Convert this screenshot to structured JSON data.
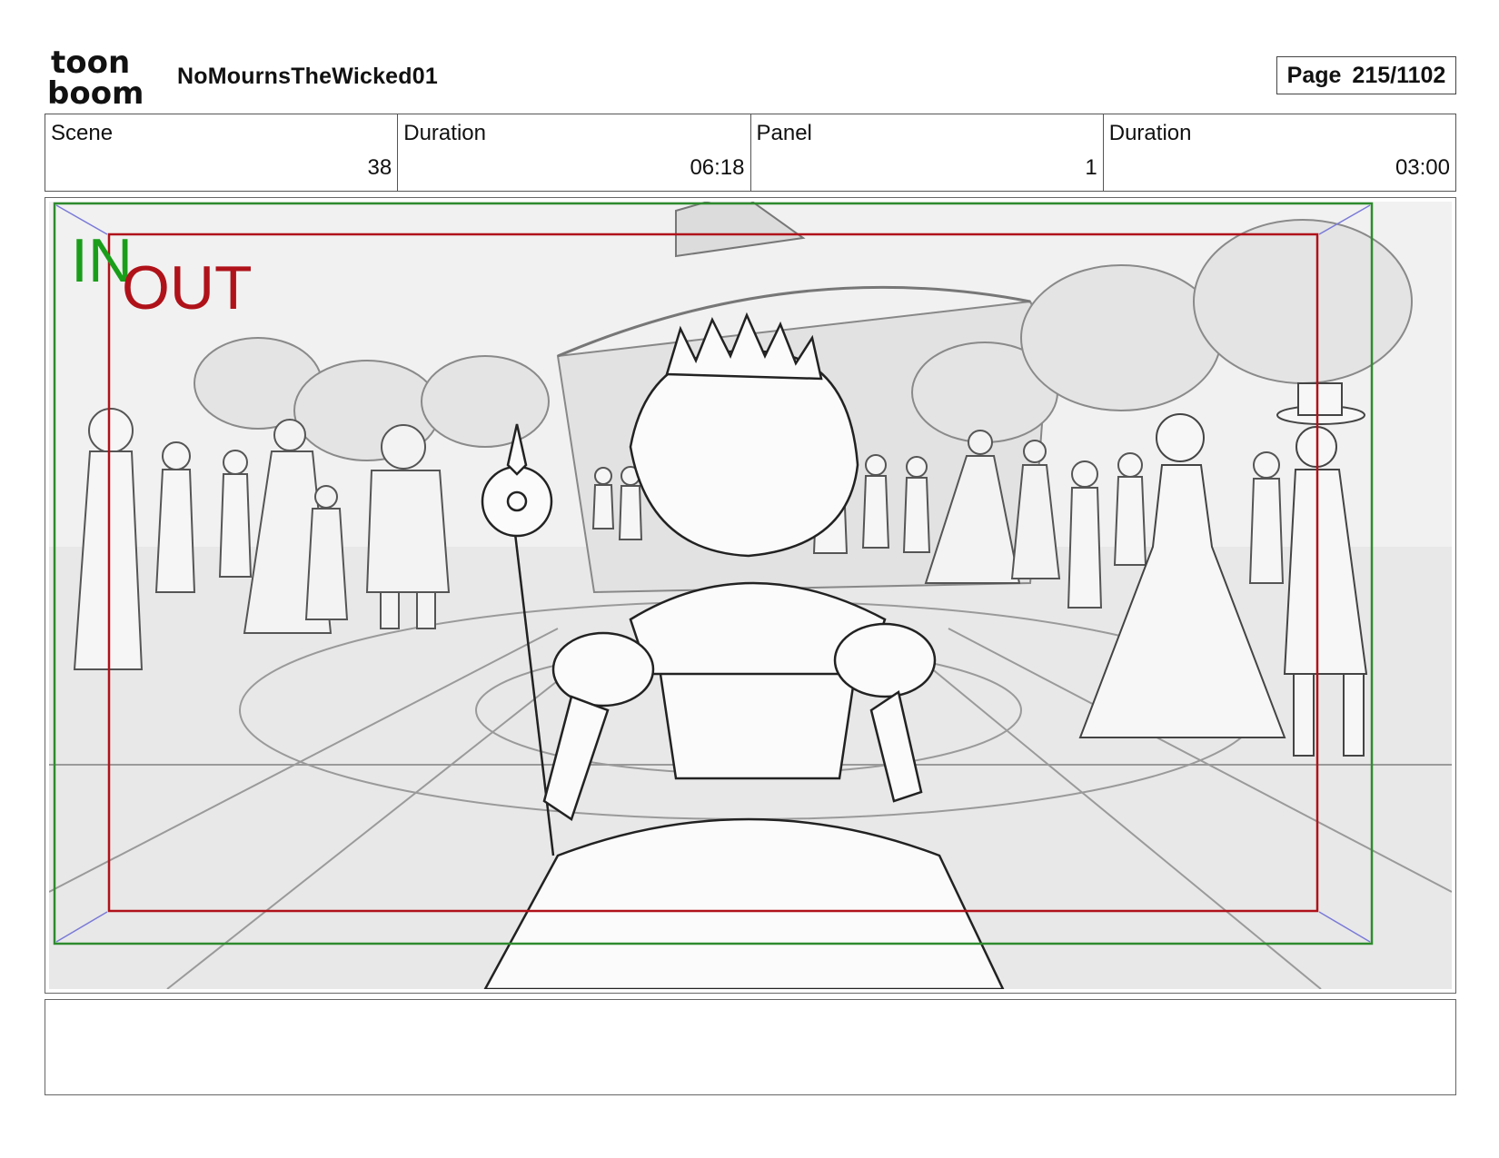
{
  "header": {
    "logo_text_top": "toon",
    "logo_text_bottom": "boom",
    "title": "NoMournsTheWicked01",
    "page_label": "Page",
    "page_value": "215/1102"
  },
  "info": {
    "scene_label": "Scene",
    "scene_value": "38",
    "scene_duration_label": "Duration",
    "scene_duration_value": "06:18",
    "panel_label": "Panel",
    "panel_value": "1",
    "panel_duration_label": "Duration",
    "panel_duration_value": "03:00"
  },
  "panel": {
    "in_label": "IN",
    "out_label": "OUT",
    "colors": {
      "in": "#1a9e1a",
      "out": "#b0121a",
      "safe_frame": "#2e8b2e",
      "title_frame": "#b0121a",
      "sketch_bg": "#e6e6e6"
    }
  },
  "notes": {
    "text": ""
  }
}
